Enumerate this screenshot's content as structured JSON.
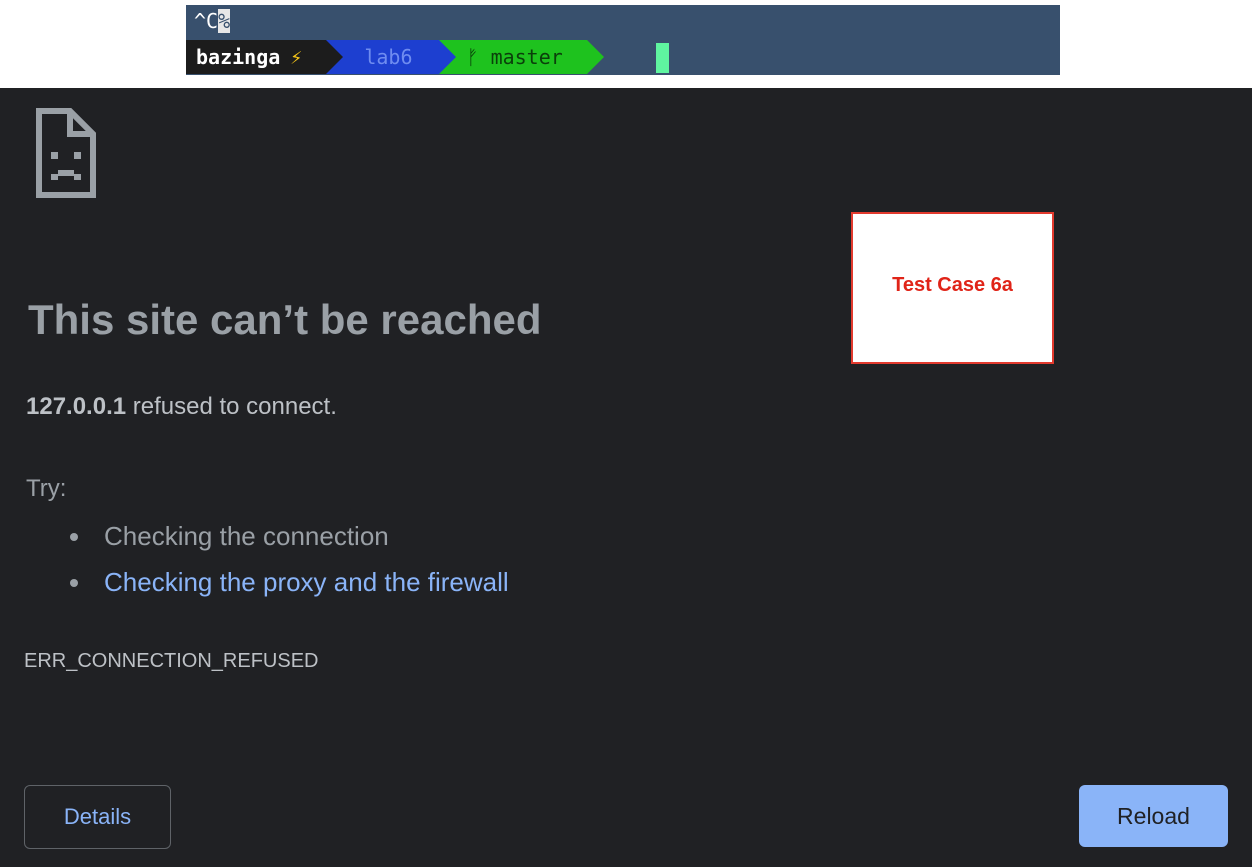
{
  "terminal": {
    "line1_prefix": "^C",
    "line1_cursor_char": "%",
    "prompt": {
      "user": "bazinga",
      "user_icon": "⚡",
      "directory": "lab6",
      "branch_icon": "ᚠ",
      "branch": "master"
    },
    "colors": {
      "background": "#38506d",
      "user_segment": "#1c1c1c",
      "dir_segment": "#1d3fd0",
      "git_segment": "#1ec21e",
      "cursor": "#5ff5a0"
    }
  },
  "error_page": {
    "icon": "sad-page-icon",
    "title": "This site can’t be reached",
    "summary": {
      "host": "127.0.0.1",
      "message": " refused to connect."
    },
    "try_label": "Try:",
    "suggestions": [
      "Checking the connection",
      "Checking the proxy and the firewall"
    ],
    "error_code": "ERR_CONNECTION_REFUSED",
    "details_label": "Details",
    "reload_label": "Reload",
    "colors": {
      "background": "#202124",
      "link": "#8ab4f8",
      "text": "#9aa0a6"
    }
  },
  "test_case": {
    "label": "Test Case 6a",
    "color": "#e02418"
  }
}
